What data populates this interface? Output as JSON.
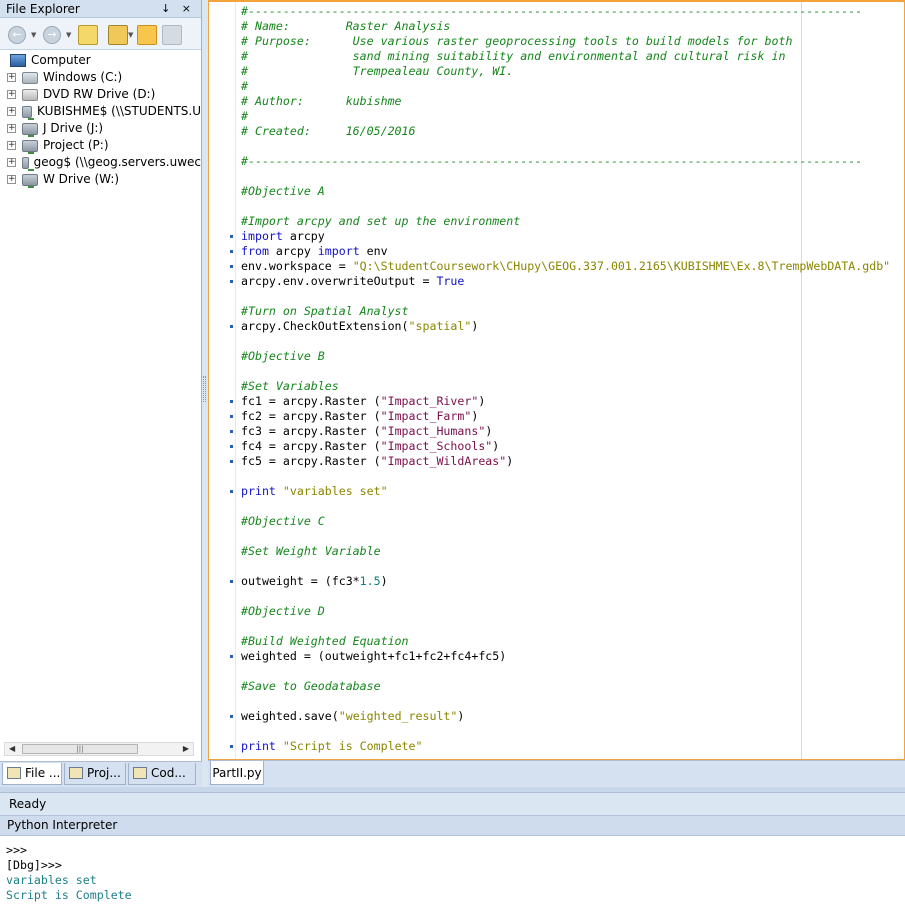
{
  "file_explorer": {
    "title": "File Explorer",
    "pin_close": "↓ ×",
    "root": "Computer",
    "drives": [
      {
        "label": "Windows (C:)",
        "kind": "sys"
      },
      {
        "label": "DVD RW Drive (D:)",
        "kind": "dvd"
      },
      {
        "label": "KUBISHME$ (\\\\STUDENTS.U",
        "kind": "net"
      },
      {
        "label": "J Drive (J:)",
        "kind": "net"
      },
      {
        "label": "Project (P:)",
        "kind": "net"
      },
      {
        "label": "geog$ (\\\\geog.servers.uwec",
        "kind": "net"
      },
      {
        "label": "W Drive (W:)",
        "kind": "net"
      }
    ],
    "tabs": [
      "File ...",
      "Proj...",
      "Cod..."
    ]
  },
  "editor": {
    "tab": "PartII.py",
    "lines": [
      {
        "dot": false,
        "parts": [
          [
            "c",
            "#----------------------------------------------------------------------------------------"
          ]
        ]
      },
      {
        "dot": false,
        "parts": [
          [
            "c",
            "# Name:        Raster Analysis"
          ]
        ]
      },
      {
        "dot": false,
        "parts": [
          [
            "c",
            "# Purpose:      Use various raster geoprocessing tools to build models for both"
          ]
        ]
      },
      {
        "dot": false,
        "parts": [
          [
            "c",
            "#               sand mining suitability and environmental and cultural risk in"
          ]
        ]
      },
      {
        "dot": false,
        "parts": [
          [
            "c",
            "#               Trempealeau County, WI."
          ]
        ]
      },
      {
        "dot": false,
        "parts": [
          [
            "c",
            "#"
          ]
        ]
      },
      {
        "dot": false,
        "parts": [
          [
            "c",
            "# Author:      kubishme"
          ]
        ]
      },
      {
        "dot": false,
        "parts": [
          [
            "c",
            "#"
          ]
        ]
      },
      {
        "dot": false,
        "parts": [
          [
            "c",
            "# Created:     16/05/2016"
          ]
        ]
      },
      {
        "dot": false,
        "parts": []
      },
      {
        "dot": false,
        "parts": [
          [
            "c",
            "#----------------------------------------------------------------------------------------"
          ]
        ]
      },
      {
        "dot": false,
        "parts": []
      },
      {
        "dot": false,
        "parts": [
          [
            "c",
            "#Objective A"
          ]
        ]
      },
      {
        "dot": false,
        "parts": []
      },
      {
        "dot": false,
        "parts": [
          [
            "c",
            "#Import arcpy and set up the environment"
          ]
        ]
      },
      {
        "dot": true,
        "parts": [
          [
            "k",
            "import"
          ],
          [
            "t",
            " arcpy"
          ]
        ]
      },
      {
        "dot": true,
        "parts": [
          [
            "k",
            "from"
          ],
          [
            "t",
            " arcpy "
          ],
          [
            "k",
            "import"
          ],
          [
            "t",
            " env"
          ]
        ]
      },
      {
        "dot": true,
        "parts": [
          [
            "t",
            "env.workspace = "
          ],
          [
            "sv",
            "\"Q:\\StudentCoursework\\CHupy\\GEOG.337.001.2165\\KUBISHME\\Ex.8\\TrempWebDATA.gdb\""
          ]
        ]
      },
      {
        "dot": true,
        "parts": [
          [
            "t",
            "arcpy.env.overwriteOutput = "
          ],
          [
            "k",
            "True"
          ]
        ]
      },
      {
        "dot": false,
        "parts": []
      },
      {
        "dot": false,
        "parts": [
          [
            "c",
            "#Turn on Spatial Analyst"
          ]
        ]
      },
      {
        "dot": true,
        "parts": [
          [
            "t",
            "arcpy.CheckOutExtension("
          ],
          [
            "sv",
            "\"spatial\""
          ],
          [
            "t",
            ")"
          ]
        ]
      },
      {
        "dot": false,
        "parts": []
      },
      {
        "dot": false,
        "parts": [
          [
            "c",
            "#Objective B"
          ]
        ]
      },
      {
        "dot": false,
        "parts": []
      },
      {
        "dot": false,
        "parts": [
          [
            "c",
            "#Set Variables"
          ]
        ]
      },
      {
        "dot": true,
        "parts": [
          [
            "t",
            "fc1 = arcpy.Raster ("
          ],
          [
            "s",
            "\"Impact_River\""
          ],
          [
            "t",
            ")"
          ]
        ]
      },
      {
        "dot": true,
        "parts": [
          [
            "t",
            "fc2 = arcpy.Raster ("
          ],
          [
            "s",
            "\"Impact_Farm\""
          ],
          [
            "t",
            ")"
          ]
        ]
      },
      {
        "dot": true,
        "parts": [
          [
            "t",
            "fc3 = arcpy.Raster ("
          ],
          [
            "s",
            "\"Impact_Humans\""
          ],
          [
            "t",
            ")"
          ]
        ]
      },
      {
        "dot": true,
        "parts": [
          [
            "t",
            "fc4 = arcpy.Raster ("
          ],
          [
            "s",
            "\"Impact_Schools\""
          ],
          [
            "t",
            ")"
          ]
        ]
      },
      {
        "dot": true,
        "parts": [
          [
            "t",
            "fc5 = arcpy.Raster ("
          ],
          [
            "s",
            "\"Impact_WildAreas\""
          ],
          [
            "t",
            ")"
          ]
        ]
      },
      {
        "dot": false,
        "parts": []
      },
      {
        "dot": true,
        "parts": [
          [
            "k",
            "print"
          ],
          [
            "t",
            " "
          ],
          [
            "sv",
            "\"variables set\""
          ]
        ]
      },
      {
        "dot": false,
        "parts": []
      },
      {
        "dot": false,
        "parts": [
          [
            "c",
            "#Objective C"
          ]
        ]
      },
      {
        "dot": false,
        "parts": []
      },
      {
        "dot": false,
        "parts": [
          [
            "c",
            "#Set Weight Variable"
          ]
        ]
      },
      {
        "dot": false,
        "parts": []
      },
      {
        "dot": true,
        "parts": [
          [
            "t",
            "outweight = (fc3*"
          ],
          [
            "n",
            "1.5"
          ],
          [
            "t",
            ")"
          ]
        ]
      },
      {
        "dot": false,
        "parts": []
      },
      {
        "dot": false,
        "parts": [
          [
            "c",
            "#Objective D"
          ]
        ]
      },
      {
        "dot": false,
        "parts": []
      },
      {
        "dot": false,
        "parts": [
          [
            "c",
            "#Build Weighted Equation"
          ]
        ]
      },
      {
        "dot": true,
        "parts": [
          [
            "t",
            "weighted = (outweight+fc1+fc2+fc4+fc5)"
          ]
        ]
      },
      {
        "dot": false,
        "parts": []
      },
      {
        "dot": false,
        "parts": [
          [
            "c",
            "#Save to Geodatabase"
          ]
        ]
      },
      {
        "dot": false,
        "parts": []
      },
      {
        "dot": true,
        "parts": [
          [
            "t",
            "weighted.save("
          ],
          [
            "sv",
            "\"weighted_result\""
          ],
          [
            "t",
            ")"
          ]
        ]
      },
      {
        "dot": false,
        "parts": []
      },
      {
        "dot": true,
        "parts": [
          [
            "k",
            "print"
          ],
          [
            "t",
            " "
          ],
          [
            "sv",
            "\"Script is Complete\""
          ]
        ]
      }
    ]
  },
  "status": "Ready",
  "interpreter": {
    "title": "Python Interpreter",
    "lines": [
      {
        "text": ">>>",
        "out": false
      },
      {
        "text": "[Dbg]>>>",
        "out": false
      },
      {
        "text": "variables set",
        "out": true
      },
      {
        "text": "Script is Complete",
        "out": true
      }
    ]
  },
  "colors": {
    "accent": "#f2a33a",
    "panel": "#dbe6f3",
    "comment": "#16861c",
    "keyword": "#1111c8"
  }
}
